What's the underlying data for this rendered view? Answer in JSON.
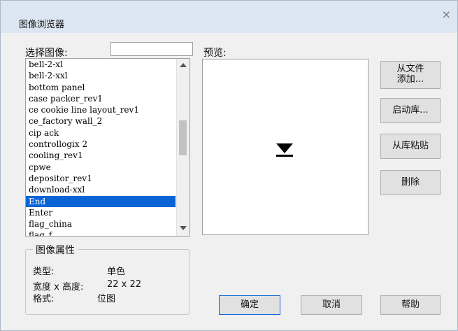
{
  "window": {
    "title": "图像浏览器",
    "close_glyph": "×"
  },
  "select": {
    "label": "选择图像:",
    "filter_value": "",
    "items": [
      "bell-2-xl",
      "bell-2-xxl",
      "bottom panel",
      "case packer_rev1",
      "ce cookie line layout_rev1",
      "ce_factory wall_2",
      "cip ack",
      "controllogix 2",
      "cooling_rev1",
      "cpwe",
      "depositor_rev1",
      "download-xxl",
      "End",
      "Enter",
      "flag_china",
      "flag_f..."
    ],
    "selected_index": 12
  },
  "preview": {
    "label": "预览:",
    "icon": "end-arrow-icon"
  },
  "properties": {
    "title": "图像属性",
    "type_label": "类型:",
    "type_value": "单色",
    "size_label": "宽度 x 高度:",
    "size_value": "22 x 22",
    "format_label": "格式:",
    "format_value": "位图"
  },
  "buttons": {
    "from_file_line1": "从文件",
    "from_file_line2": "添加...",
    "start_library": "启动库...",
    "paste_from_library": "从库粘贴",
    "delete": "删除",
    "ok": "确定",
    "cancel": "取消",
    "help": "帮助"
  },
  "colors": {
    "selection": "#0a64d6",
    "title_bar": "#dbe6f2",
    "dialog_bg": "#f0f0f0"
  }
}
